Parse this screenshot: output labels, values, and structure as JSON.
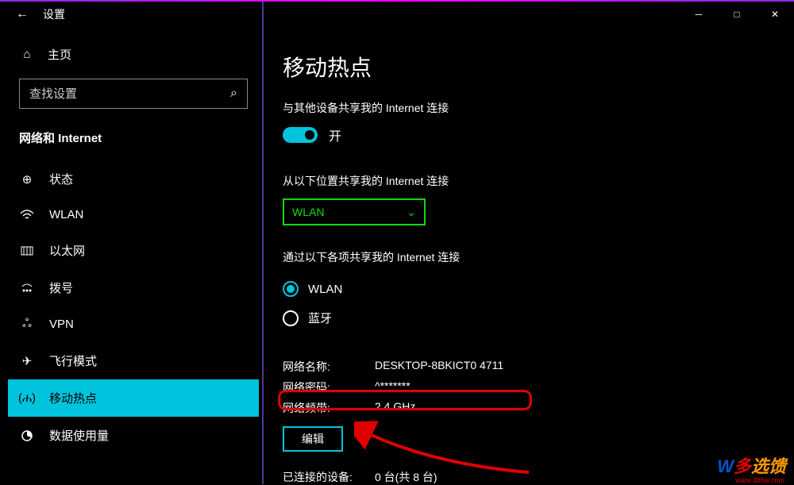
{
  "window": {
    "title": "设置",
    "minimize": "─",
    "maximize": "□",
    "close": "✕"
  },
  "sidebar": {
    "home": "主页",
    "search_placeholder": "查找设置",
    "section": "网络和 Internet",
    "items": [
      {
        "icon": "status",
        "label": "状态"
      },
      {
        "icon": "wifi",
        "label": "WLAN"
      },
      {
        "icon": "ethernet",
        "label": "以太网"
      },
      {
        "icon": "dialup",
        "label": "拨号"
      },
      {
        "icon": "vpn",
        "label": "VPN"
      },
      {
        "icon": "airplane",
        "label": "飞行模式"
      },
      {
        "icon": "hotspot",
        "label": "移动热点"
      },
      {
        "icon": "datausage",
        "label": "数据使用量"
      }
    ]
  },
  "content": {
    "title": "移动热点",
    "share_label": "与其他设备共享我的 Internet 连接",
    "toggle_state": "开",
    "share_from_label": "从以下位置共享我的 Internet 连接",
    "dropdown_value": "WLAN",
    "share_via_label": "通过以下各项共享我的 Internet 连接",
    "radio_options": [
      {
        "label": "WLAN",
        "checked": true
      },
      {
        "label": "蓝牙",
        "checked": false
      }
    ],
    "network_name_label": "网络名称:",
    "network_name_value": "DESKTOP-8BKICT0 4711",
    "network_password_label": "网络密码:",
    "network_password_value": "^*******",
    "network_band_label": "网络频带:",
    "network_band_value": "2.4 GHz",
    "edit_button": "编辑",
    "connected_label": "已连接的设备:",
    "connected_value": "0 台(共 8 台)"
  },
  "watermark": {
    "text1": "W",
    "text2": "多",
    "text3": "选馈",
    "url": "www.386w.com"
  }
}
